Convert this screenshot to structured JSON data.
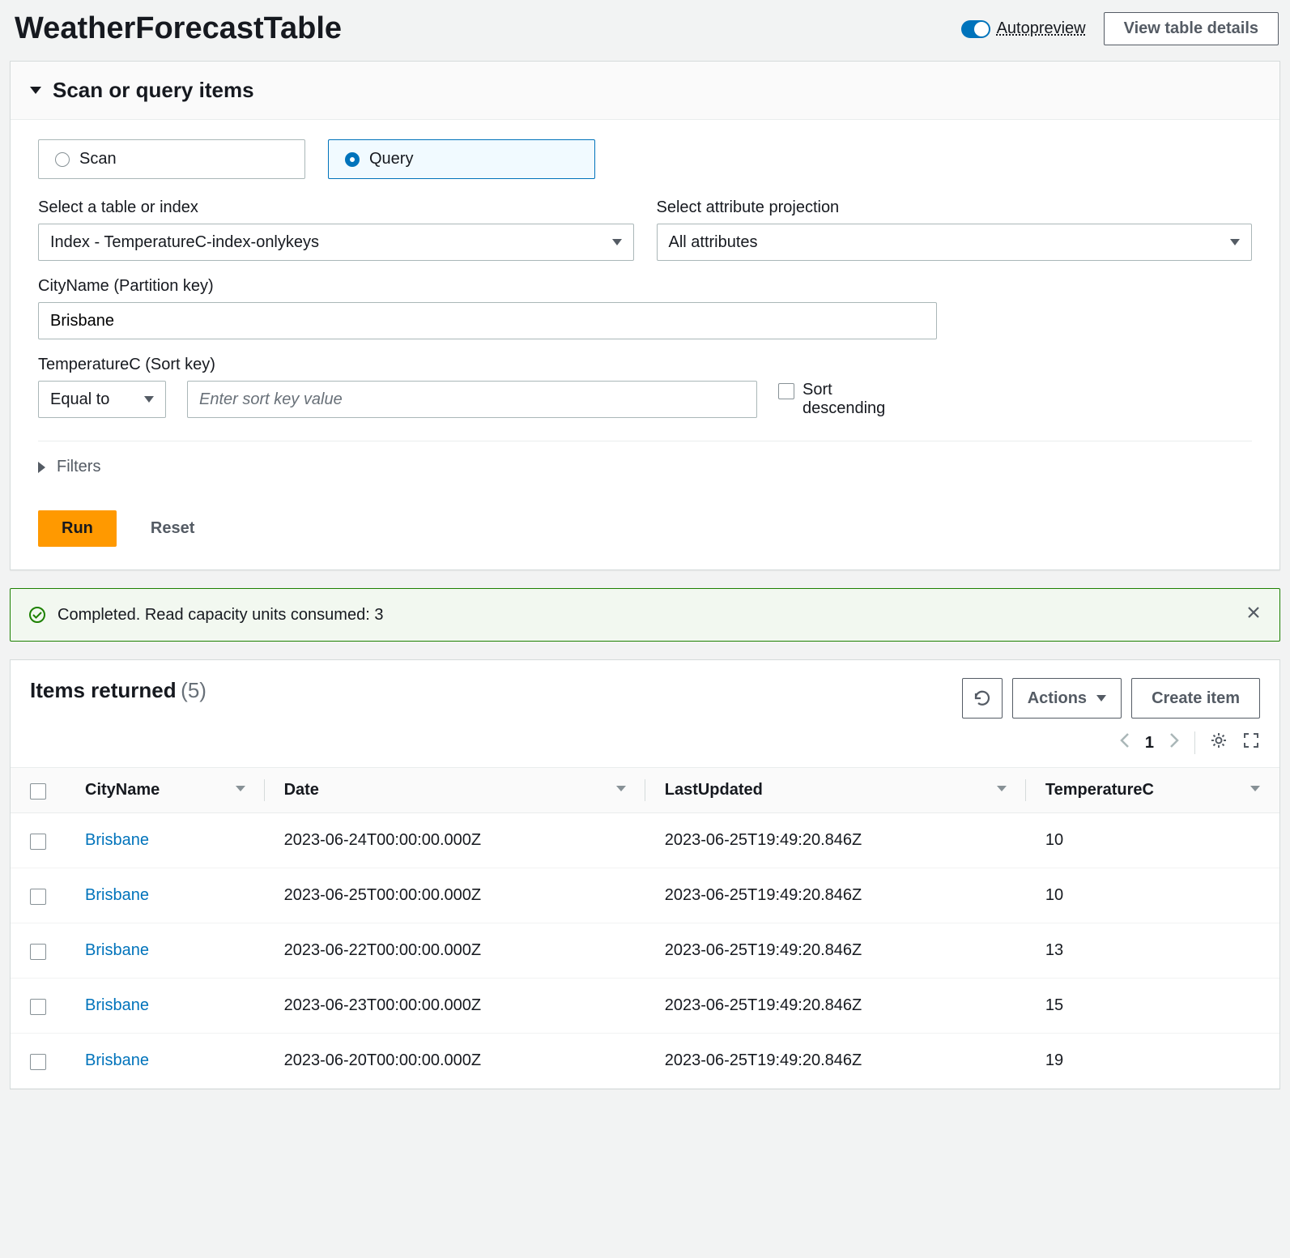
{
  "header": {
    "title": "WeatherForecastTable",
    "autopreview_label": "Autopreview",
    "view_details_label": "View table details"
  },
  "query_panel": {
    "title": "Scan or query items",
    "mode_scan_label": "Scan",
    "mode_query_label": "Query",
    "table_index_label": "Select a table or index",
    "table_index_value": "Index - TemperatureC-index-onlykeys",
    "projection_label": "Select attribute projection",
    "projection_value": "All attributes",
    "partition_key_label": "CityName (Partition key)",
    "partition_key_value": "Brisbane",
    "sort_key_label": "TemperatureC (Sort key)",
    "sort_key_op": "Equal to",
    "sort_key_placeholder": "Enter sort key value",
    "sort_descending_label": "Sort descending",
    "filters_label": "Filters",
    "run_label": "Run",
    "reset_label": "Reset"
  },
  "alert": {
    "message": "Completed. Read capacity units consumed: 3"
  },
  "results": {
    "title": "Items returned",
    "count_display": "(5)",
    "actions_label": "Actions",
    "create_label": "Create item",
    "page": "1",
    "columns": {
      "city": "CityName",
      "date": "Date",
      "updated": "LastUpdated",
      "temp": "TemperatureC"
    },
    "rows": [
      {
        "city": "Brisbane",
        "date": "2023-06-24T00:00:00.000Z",
        "updated": "2023-06-25T19:49:20.846Z",
        "temp": "10"
      },
      {
        "city": "Brisbane",
        "date": "2023-06-25T00:00:00.000Z",
        "updated": "2023-06-25T19:49:20.846Z",
        "temp": "10"
      },
      {
        "city": "Brisbane",
        "date": "2023-06-22T00:00:00.000Z",
        "updated": "2023-06-25T19:49:20.846Z",
        "temp": "13"
      },
      {
        "city": "Brisbane",
        "date": "2023-06-23T00:00:00.000Z",
        "updated": "2023-06-25T19:49:20.846Z",
        "temp": "15"
      },
      {
        "city": "Brisbane",
        "date": "2023-06-20T00:00:00.000Z",
        "updated": "2023-06-25T19:49:20.846Z",
        "temp": "19"
      }
    ]
  }
}
